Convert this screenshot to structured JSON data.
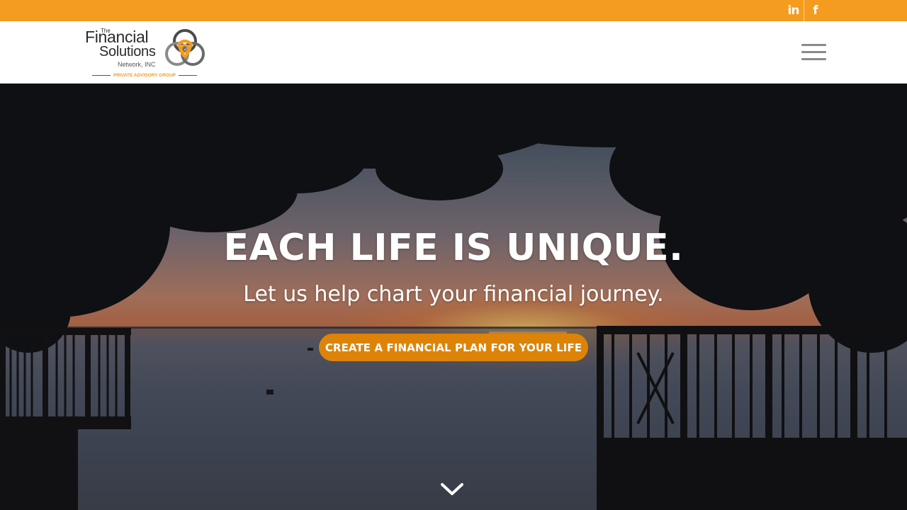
{
  "colors": {
    "accent": "#f39c1f",
    "button": "#dd8307",
    "text_on_dark": "#ffffff",
    "menu_icon": "#8a8a8a"
  },
  "topbar": {
    "social": [
      {
        "icon": "linkedin-icon",
        "label": "in"
      },
      {
        "icon": "facebook-icon",
        "label": "f"
      }
    ]
  },
  "header": {
    "logo": {
      "the": "The",
      "line1": "Financial",
      "line2": "Solutions",
      "line3": "Network, INC",
      "tagline": "PRIVATE ADVISORY GROUP"
    },
    "menu_icon": "hamburger-menu-icon"
  },
  "hero": {
    "title": "EACH LIFE IS UNIQUE.",
    "subtitle": "Let us help chart your financial journey.",
    "cta_label": "CREATE A FINANCIAL PLAN FOR YOUR LIFE",
    "scroll_icon": "chevron-down-icon"
  }
}
